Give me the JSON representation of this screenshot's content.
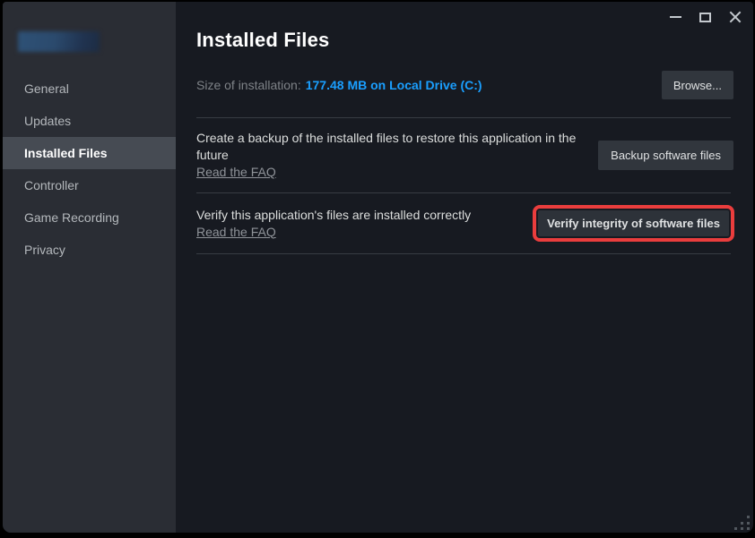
{
  "colors": {
    "main_bg": "#171a21",
    "sidebar_bg": "#2a2d34",
    "selected_bg": "#464b53",
    "button_bg": "#31363d",
    "accent_blue": "#1a9fff",
    "highlight_red": "#ea3d3d"
  },
  "sidebar": {
    "items": [
      {
        "label": "General",
        "selected": false
      },
      {
        "label": "Updates",
        "selected": false
      },
      {
        "label": "Installed Files",
        "selected": true
      },
      {
        "label": "Controller",
        "selected": false
      },
      {
        "label": "Game Recording",
        "selected": false
      },
      {
        "label": "Privacy",
        "selected": false
      }
    ]
  },
  "main": {
    "title": "Installed Files",
    "size_row": {
      "label": "Size of installation:",
      "value": "177.48 MB on Local Drive (C:)",
      "browse_button": "Browse..."
    },
    "backup_row": {
      "text": "Create a backup of the installed files to restore this application in the future",
      "faq_link": "Read the FAQ",
      "button": "Backup software files"
    },
    "verify_row": {
      "text": "Verify this application's files are installed correctly",
      "faq_link": "Read the FAQ",
      "button": "Verify integrity of software files",
      "highlighted": true
    }
  }
}
